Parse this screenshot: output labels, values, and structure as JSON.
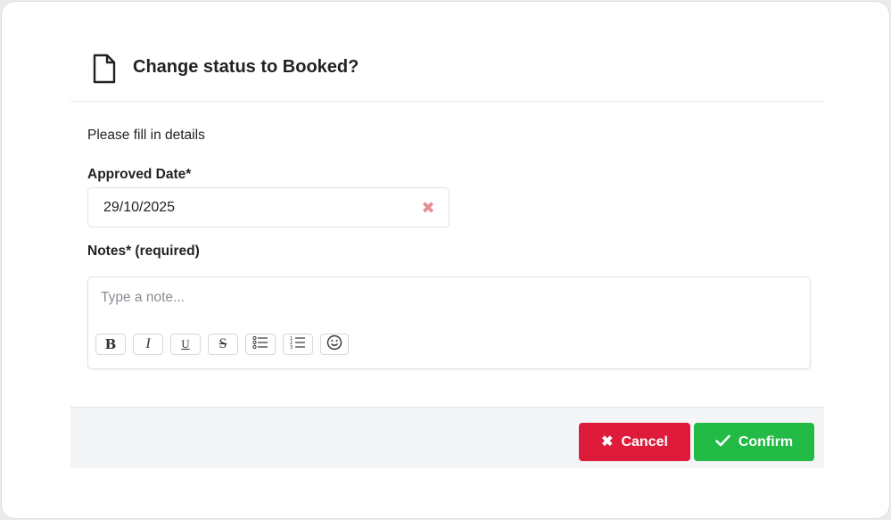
{
  "dialog": {
    "icon": "document-icon",
    "title": "Change status to Booked?"
  },
  "form": {
    "instructions": "Please fill in details",
    "date_label": "Approved Date*",
    "date_value": "29/10/2025",
    "clear_icon": "x-icon",
    "clear_color": "#e58f94",
    "notes_label": "Notes* (required)",
    "notes_placeholder": "Type a note...",
    "notes_value": "",
    "toolbar": [
      {
        "name": "bold-button",
        "glyph": "B"
      },
      {
        "name": "italic-button",
        "glyph": "I"
      },
      {
        "name": "underline-button",
        "glyph": "U"
      },
      {
        "name": "strikethrough-button",
        "glyph": "S"
      },
      {
        "name": "bullet-list-button",
        "icon": "bullet-list-icon"
      },
      {
        "name": "numbered-list-button",
        "icon": "numbered-list-icon"
      },
      {
        "name": "emoji-button",
        "icon": "smiley-icon"
      }
    ]
  },
  "footer": {
    "cancel_label": "Cancel",
    "cancel_icon": "x-icon",
    "cancel_color": "#de1b3a",
    "confirm_label": "Confirm",
    "confirm_icon": "check-icon",
    "confirm_color": "#22bb45"
  }
}
